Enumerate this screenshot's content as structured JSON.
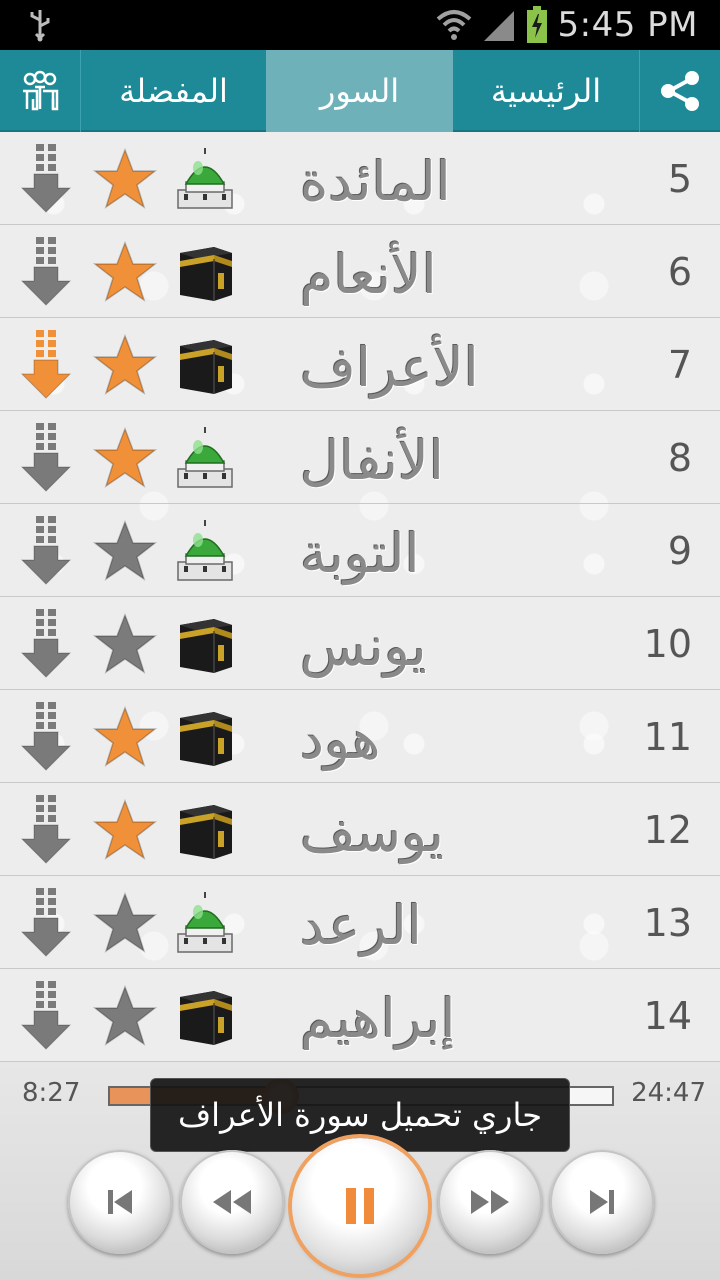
{
  "status_bar": {
    "time": "5:45 PM",
    "icons": [
      "usb-icon",
      "wifi-icon",
      "signal-icon",
      "battery-charging-icon"
    ]
  },
  "tabs": {
    "favorites": "المفضلة",
    "surahs": "السور",
    "home": "الرئيسية",
    "active": "surahs",
    "left_icon": "reciters-group-icon",
    "right_icon": "share-icon"
  },
  "surahs": [
    {
      "number": "5",
      "name": "المائدة",
      "place": "medina",
      "favorite": true,
      "downloading": false
    },
    {
      "number": "6",
      "name": "الأنعام",
      "place": "mecca",
      "favorite": true,
      "downloading": false
    },
    {
      "number": "7",
      "name": "الأعراف",
      "place": "mecca",
      "favorite": true,
      "downloading": true
    },
    {
      "number": "8",
      "name": "الأنفال",
      "place": "medina",
      "favorite": true,
      "downloading": false
    },
    {
      "number": "9",
      "name": "التوبة",
      "place": "medina",
      "favorite": false,
      "downloading": false
    },
    {
      "number": "10",
      "name": "يونس",
      "place": "mecca",
      "favorite": false,
      "downloading": false
    },
    {
      "number": "11",
      "name": "هود",
      "place": "mecca",
      "favorite": true,
      "downloading": false
    },
    {
      "number": "12",
      "name": "يوسف",
      "place": "mecca",
      "favorite": true,
      "downloading": false
    },
    {
      "number": "13",
      "name": "الرعد",
      "place": "medina",
      "favorite": false,
      "downloading": false
    },
    {
      "number": "14",
      "name": "إبراهيم",
      "place": "mecca",
      "favorite": false,
      "downloading": false
    }
  ],
  "player": {
    "elapsed": "8:27",
    "total": "24:47",
    "progress_fraction": 0.34,
    "toast": "جاري تحميل سورة الأعراف",
    "controls": [
      "skip-previous-icon",
      "rewind-icon",
      "pause-icon",
      "fast-forward-icon",
      "skip-next-icon"
    ]
  },
  "colors": {
    "tab_bar": "#1f8a97",
    "tab_active": "#6fb1b9",
    "star_on": "#f0913a",
    "star_off": "#7b7b7b",
    "download_active": "#f0913a",
    "download_idle": "#7a7a7a",
    "progress": "#e8935a"
  }
}
